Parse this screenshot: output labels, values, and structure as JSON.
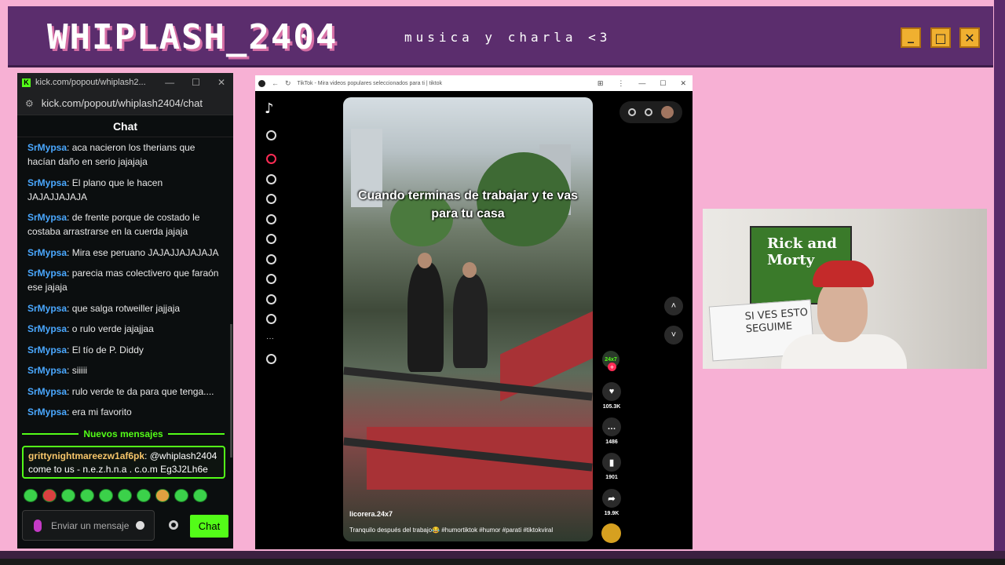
{
  "overlay": {
    "channel_name": "WHIPLASH_2404",
    "tagline": "musica y charla <3",
    "window_buttons": {
      "minimize": "_",
      "maximize": "□",
      "close": "✕"
    }
  },
  "chat_window": {
    "tab_title": "kick.com/popout/whiplash2...",
    "address": "kick.com/popout/whiplash2404/chat",
    "header": "Chat",
    "messages": [
      {
        "user": "SrMypsa",
        "text": ": aca nacieron los therians que hacían daño en serio jajajaja"
      },
      {
        "user": "SrMypsa",
        "text": ": El plano que le hacen JAJAJJAJAJA"
      },
      {
        "user": "SrMypsa",
        "text": ": de frente porque de costado le costaba arrastrarse en la cuerda jajaja"
      },
      {
        "user": "SrMypsa",
        "text": ": Mira ese peruano JAJAJJAJAJAJA"
      },
      {
        "user": "SrMypsa",
        "text": ": parecia mas colectivero que faraón ese jajaja"
      },
      {
        "user": "SrMypsa",
        "text": ": que salga rotweiller jajjaja"
      },
      {
        "user": "SrMypsa",
        "text": ": o rulo verde jajajjaa"
      },
      {
        "user": "SrMypsa",
        "text": ": El tío de P. Diddy"
      },
      {
        "user": "SrMypsa",
        "text": ": siiiii"
      },
      {
        "user": "SrMypsa",
        "text": ": rulo verde te da para que tenga...."
      },
      {
        "user": "SrMypsa",
        "text": ": era mi favorito"
      }
    ],
    "new_messages_label": "Nuevos mensajes",
    "pinned": {
      "user": "grittynightmareezw1af6pk",
      "text": ": @whiplash2404 come to us - n.e.z.h.n.a . c.o.m Eg3J2Lh6e"
    },
    "input_placeholder": "Enviar un mensaje",
    "send_label": "Chat",
    "accent": "#53fc18"
  },
  "tiktok": {
    "tab_title": "TikTok - Mira videos populares seleccionados para ti | tiktok",
    "video_caption": "Cuando terminas de trabajar y te vas para tu casa",
    "author": "licorera.24x7",
    "description": "Tranquilo después del trabajo😂 #humortiktok #humor #parati #tiktokviral",
    "account_badge": "24x7",
    "likes": "105.3K",
    "comments": "1486",
    "saves": "1901",
    "shares": "19.9K"
  },
  "webcam": {
    "poster_title": "Rick and Morty",
    "note_text": "SI VES ESTO SEGUIME"
  }
}
